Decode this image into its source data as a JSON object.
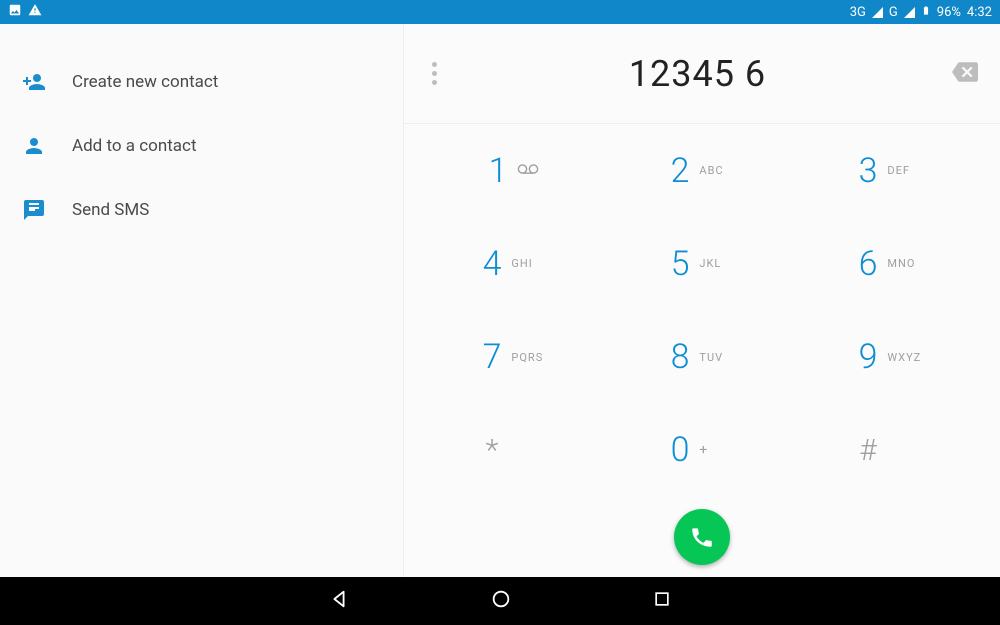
{
  "status": {
    "net1": "3G",
    "net2": "G",
    "battery": "96%",
    "clock": "4:32"
  },
  "actions": {
    "create": "Create new contact",
    "add": "Add to a contact",
    "sms": "Send SMS"
  },
  "dialer": {
    "number": "12345 6",
    "keys": {
      "k1": {
        "d": "1",
        "l": ""
      },
      "k2": {
        "d": "2",
        "l": "ABC"
      },
      "k3": {
        "d": "3",
        "l": "DEF"
      },
      "k4": {
        "d": "4",
        "l": "GHI"
      },
      "k5": {
        "d": "5",
        "l": "JKL"
      },
      "k6": {
        "d": "6",
        "l": "MNO"
      },
      "k7": {
        "d": "7",
        "l": "PQRS"
      },
      "k8": {
        "d": "8",
        "l": "TUV"
      },
      "k9": {
        "d": "9",
        "l": "WXYZ"
      },
      "kstar": {
        "d": "*"
      },
      "k0": {
        "d": "0",
        "l": "+"
      },
      "khash": {
        "d": "#"
      }
    }
  }
}
